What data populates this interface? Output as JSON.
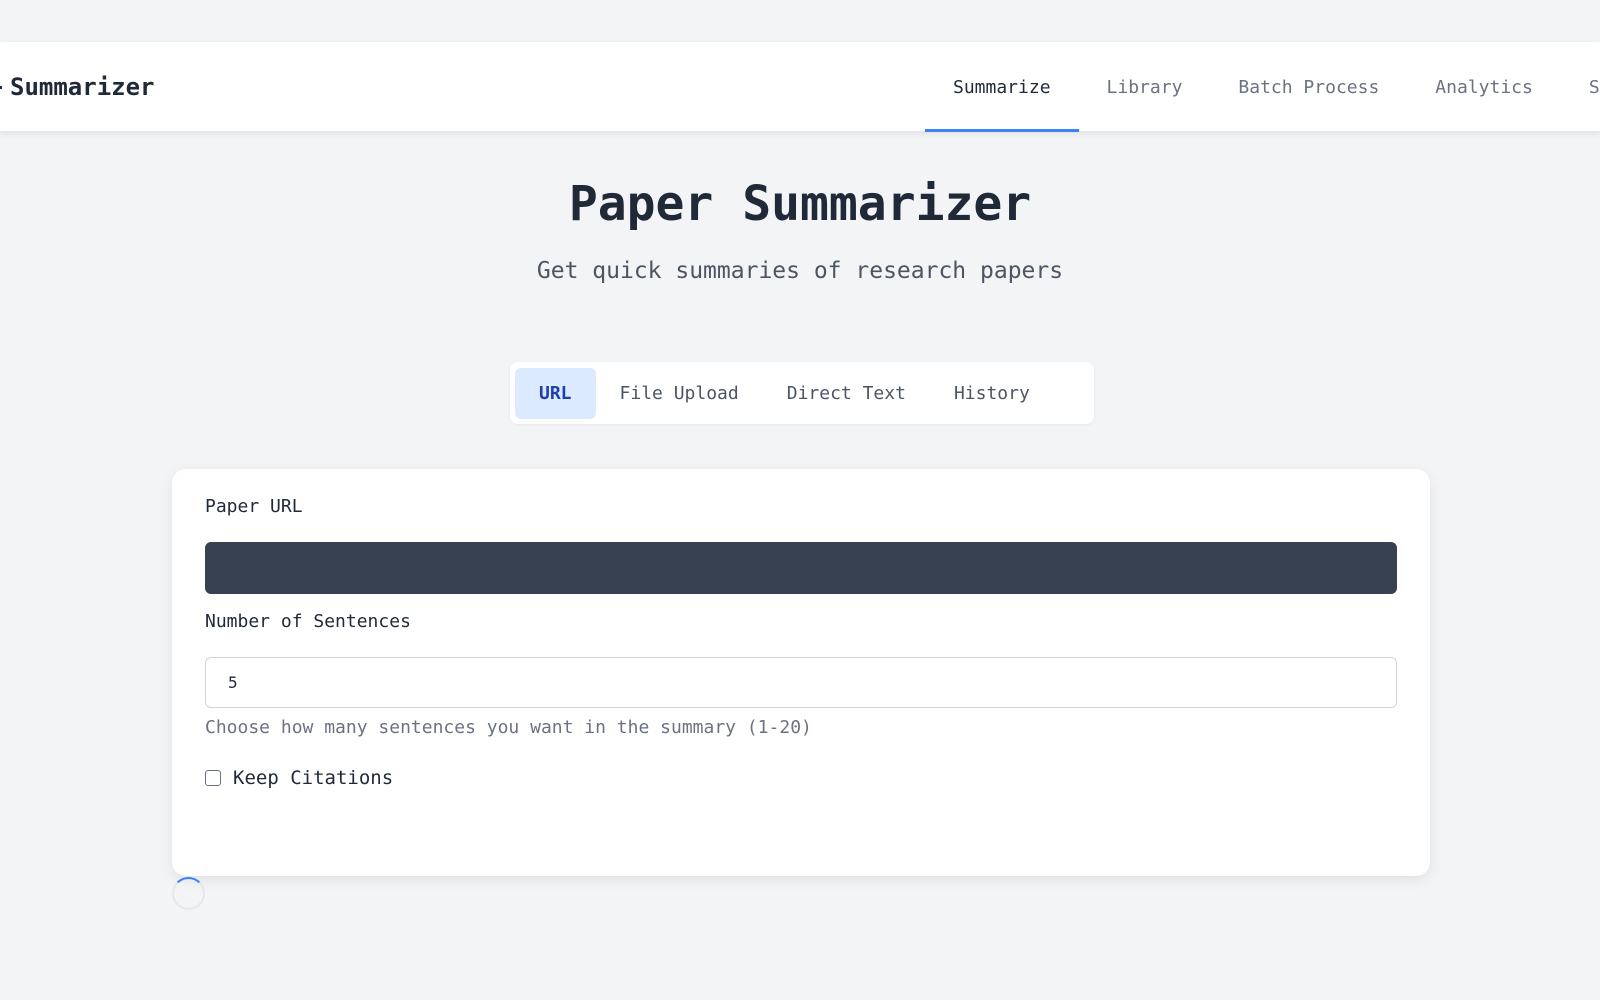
{
  "header": {
    "brand": "Summarizer",
    "nav": [
      {
        "label": "Summarize",
        "active": true
      },
      {
        "label": "Library",
        "active": false
      },
      {
        "label": "Batch Process",
        "active": false
      },
      {
        "label": "Analytics",
        "active": false
      },
      {
        "label": "Se",
        "active": false
      }
    ]
  },
  "hero": {
    "title": "Paper Summarizer",
    "subtitle": "Get quick summaries of research papers"
  },
  "tabs": [
    {
      "label": "URL",
      "active": true
    },
    {
      "label": "File Upload",
      "active": false
    },
    {
      "label": "Direct Text",
      "active": false
    },
    {
      "label": "History",
      "active": false
    }
  ],
  "form": {
    "url_label": "Paper URL",
    "url_value": "",
    "sentences_label": "Number of Sentences",
    "sentences_value": "5",
    "sentences_hint": "Choose how many sentences you want in the summary (1-20)",
    "keep_citations_label": "Keep Citations",
    "keep_citations_checked": false
  },
  "colors": {
    "accent": "#3b82f6",
    "active_tab_bg": "#dbeafe",
    "url_input_bg": "#374151"
  }
}
